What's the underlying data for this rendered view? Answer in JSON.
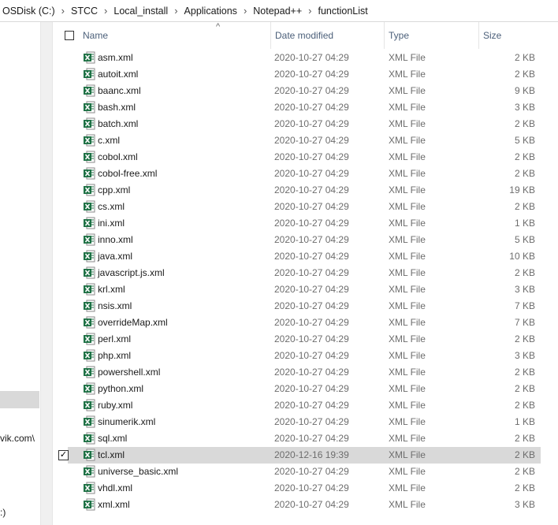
{
  "breadcrumb": [
    "OSDisk (C:)",
    "STCC",
    "Local_install",
    "Applications",
    "Notepad++",
    "functionList"
  ],
  "breadcrumb_separator": "›",
  "nav": {
    "fragment_1": "vik.com\\",
    "fragment_2": ":)"
  },
  "columns": {
    "name": "Name",
    "date": "Date modified",
    "type": "Type",
    "size": "Size",
    "sort_glyph": "^"
  },
  "check_glyph": "✓",
  "files": [
    {
      "name": "asm.xml",
      "date": "2020-10-27 04:29",
      "type": "XML File",
      "size": "2 KB"
    },
    {
      "name": "autoit.xml",
      "date": "2020-10-27 04:29",
      "type": "XML File",
      "size": "2 KB"
    },
    {
      "name": "baanc.xml",
      "date": "2020-10-27 04:29",
      "type": "XML File",
      "size": "9 KB"
    },
    {
      "name": "bash.xml",
      "date": "2020-10-27 04:29",
      "type": "XML File",
      "size": "3 KB"
    },
    {
      "name": "batch.xml",
      "date": "2020-10-27 04:29",
      "type": "XML File",
      "size": "2 KB"
    },
    {
      "name": "c.xml",
      "date": "2020-10-27 04:29",
      "type": "XML File",
      "size": "5 KB"
    },
    {
      "name": "cobol.xml",
      "date": "2020-10-27 04:29",
      "type": "XML File",
      "size": "2 KB"
    },
    {
      "name": "cobol-free.xml",
      "date": "2020-10-27 04:29",
      "type": "XML File",
      "size": "2 KB"
    },
    {
      "name": "cpp.xml",
      "date": "2020-10-27 04:29",
      "type": "XML File",
      "size": "19 KB"
    },
    {
      "name": "cs.xml",
      "date": "2020-10-27 04:29",
      "type": "XML File",
      "size": "2 KB"
    },
    {
      "name": "ini.xml",
      "date": "2020-10-27 04:29",
      "type": "XML File",
      "size": "1 KB"
    },
    {
      "name": "inno.xml",
      "date": "2020-10-27 04:29",
      "type": "XML File",
      "size": "5 KB"
    },
    {
      "name": "java.xml",
      "date": "2020-10-27 04:29",
      "type": "XML File",
      "size": "10 KB"
    },
    {
      "name": "javascript.js.xml",
      "date": "2020-10-27 04:29",
      "type": "XML File",
      "size": "2 KB"
    },
    {
      "name": "krl.xml",
      "date": "2020-10-27 04:29",
      "type": "XML File",
      "size": "3 KB"
    },
    {
      "name": "nsis.xml",
      "date": "2020-10-27 04:29",
      "type": "XML File",
      "size": "7 KB"
    },
    {
      "name": "overrideMap.xml",
      "date": "2020-10-27 04:29",
      "type": "XML File",
      "size": "7 KB"
    },
    {
      "name": "perl.xml",
      "date": "2020-10-27 04:29",
      "type": "XML File",
      "size": "2 KB"
    },
    {
      "name": "php.xml",
      "date": "2020-10-27 04:29",
      "type": "XML File",
      "size": "3 KB"
    },
    {
      "name": "powershell.xml",
      "date": "2020-10-27 04:29",
      "type": "XML File",
      "size": "2 KB"
    },
    {
      "name": "python.xml",
      "date": "2020-10-27 04:29",
      "type": "XML File",
      "size": "2 KB"
    },
    {
      "name": "ruby.xml",
      "date": "2020-10-27 04:29",
      "type": "XML File",
      "size": "2 KB"
    },
    {
      "name": "sinumerik.xml",
      "date": "2020-10-27 04:29",
      "type": "XML File",
      "size": "1 KB"
    },
    {
      "name": "sql.xml",
      "date": "2020-10-27 04:29",
      "type": "XML File",
      "size": "2 KB"
    },
    {
      "name": "tcl.xml",
      "date": "2020-12-16 19:39",
      "type": "XML File",
      "size": "2 KB",
      "selected": true
    },
    {
      "name": "universe_basic.xml",
      "date": "2020-10-27 04:29",
      "type": "XML File",
      "size": "2 KB"
    },
    {
      "name": "vhdl.xml",
      "date": "2020-10-27 04:29",
      "type": "XML File",
      "size": "2 KB"
    },
    {
      "name": "xml.xml",
      "date": "2020-10-27 04:29",
      "type": "XML File",
      "size": "3 KB"
    }
  ],
  "file_icon": "excel-xml-file-icon",
  "colors": {
    "selection": "#d9d9d9",
    "header_text": "#4c607a",
    "icon_green": "#1e7145",
    "meta_text": "#6d6d6d"
  }
}
